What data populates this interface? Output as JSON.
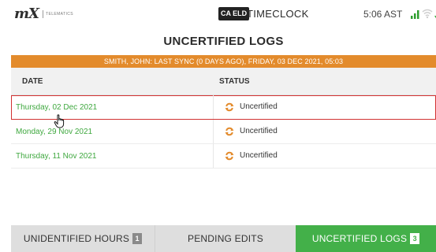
{
  "header": {
    "logo_text": "mX",
    "logo_sub": "TELEMATICS",
    "eld_badge": "CA ELD",
    "app_name": "TIMECLOCK",
    "time": "5:06 AST",
    "icons": [
      "signal-icon",
      "wifi-icon",
      "sync-icon"
    ],
    "colors": {
      "signal": "#2e9e2e",
      "sync": "#43b049"
    }
  },
  "page_title": "UNCERTIFIED LOGS",
  "banner": {
    "text": "SMITH, JOHN: LAST SYNC (0 DAYS AGO), FRIDAY, 03 DEC 2021, 05:03",
    "color": "#e38b2c"
  },
  "table": {
    "columns": [
      "DATE",
      "STATUS"
    ],
    "rows": [
      {
        "date": "Thursday, 02 Dec 2021",
        "status": "Uncertified",
        "selected": true
      },
      {
        "date": "Monday, 29 Nov 2021",
        "status": "Uncertified",
        "selected": false
      },
      {
        "date": "Thursday, 11 Nov 2021",
        "status": "Uncertified",
        "selected": false
      }
    ]
  },
  "bottom_tabs": [
    {
      "label": "UNIDENTIFIED HOURS",
      "count": "1",
      "active": false
    },
    {
      "label": "PENDING EDITS",
      "count": "",
      "active": false
    },
    {
      "label": "UNCERTIFIED LOGS",
      "count": "3",
      "active": true
    }
  ],
  "accent_color": "#43b049",
  "selection_color": "#d23232"
}
